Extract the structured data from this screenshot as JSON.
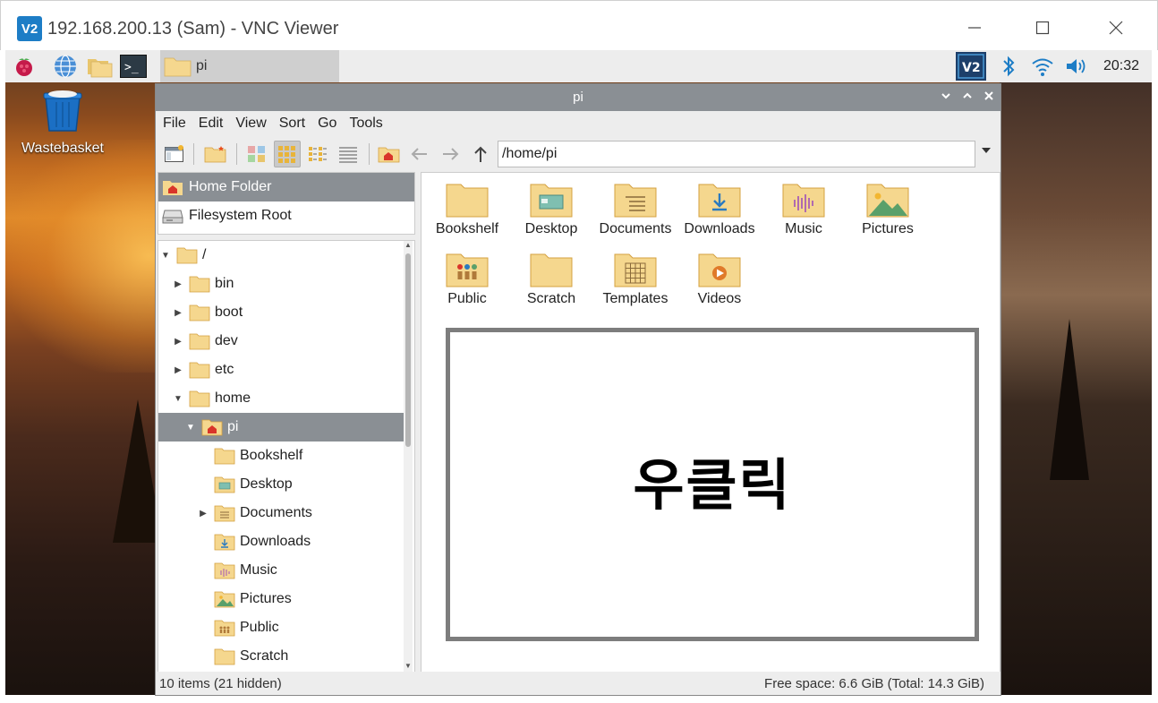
{
  "vnc": {
    "title": "192.168.200.13 (Sam) - VNC Viewer",
    "logo_text": "V2"
  },
  "taskbar": {
    "window_button_label": "pi",
    "clock": "20:32"
  },
  "desktop": {
    "icons": [
      {
        "label": "Wastebasket",
        "icon": "trash-icon"
      }
    ]
  },
  "file_manager": {
    "title": "pi",
    "menu": [
      "File",
      "Edit",
      "View",
      "Sort",
      "Go",
      "Tools"
    ],
    "path": "/home/pi",
    "places": [
      {
        "label": "Home Folder",
        "icon": "home-icon",
        "selected": true
      },
      {
        "label": "Filesystem Root",
        "icon": "drive-icon",
        "selected": false
      }
    ],
    "tree": [
      {
        "label": "/",
        "expanded": true
      },
      {
        "label": "bin",
        "expanded": false
      },
      {
        "label": "boot",
        "expanded": false
      },
      {
        "label": "dev",
        "expanded": false
      },
      {
        "label": "etc",
        "expanded": false
      },
      {
        "label": "home",
        "expanded": true
      },
      {
        "label": "pi",
        "expanded": true,
        "selected": true
      },
      {
        "label": "Bookshelf"
      },
      {
        "label": "Desktop"
      },
      {
        "label": "Documents",
        "expanded": false
      },
      {
        "label": "Downloads"
      },
      {
        "label": "Music"
      },
      {
        "label": "Pictures"
      },
      {
        "label": "Public"
      },
      {
        "label": "Scratch"
      }
    ],
    "items": [
      {
        "label": "Bookshelf",
        "icon": "folder-icon"
      },
      {
        "label": "Desktop",
        "icon": "desktop-folder-icon"
      },
      {
        "label": "Documents",
        "icon": "documents-folder-icon"
      },
      {
        "label": "Downloads",
        "icon": "downloads-folder-icon"
      },
      {
        "label": "Music",
        "icon": "music-folder-icon"
      },
      {
        "label": "Pictures",
        "icon": "pictures-folder-icon"
      },
      {
        "label": "Public",
        "icon": "public-folder-icon"
      },
      {
        "label": "Scratch",
        "icon": "folder-icon"
      },
      {
        "label": "Templates",
        "icon": "templates-folder-icon"
      },
      {
        "label": "Videos",
        "icon": "videos-folder-icon"
      }
    ],
    "status_left": "10 items (21 hidden)",
    "status_right": "Free space: 6.6 GiB (Total: 14.3 GiB)"
  },
  "overlay": {
    "text": "우클릭"
  },
  "colors": {
    "selection": "#8a8f94",
    "folder": "#f5d78e",
    "vnc_blue": "#1d7dc6"
  }
}
